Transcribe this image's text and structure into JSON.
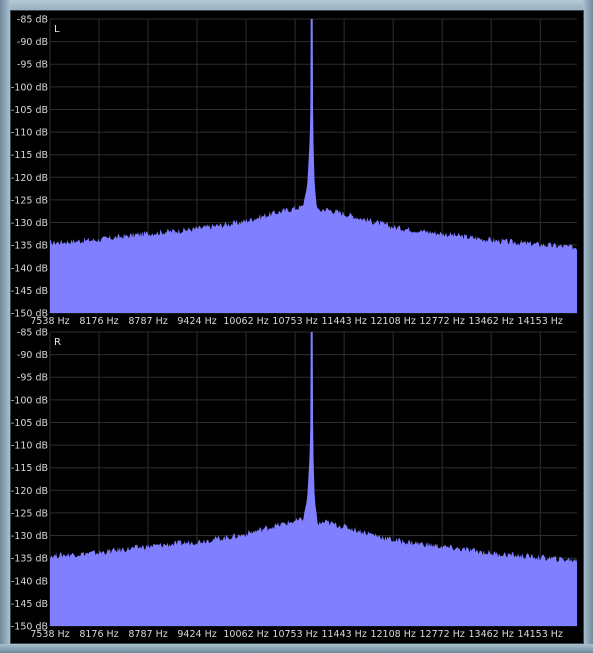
{
  "chart_data": [
    {
      "type": "area",
      "channel": "L",
      "ylabel_unit": "dB",
      "ylim": [
        -150,
        -85
      ],
      "y_ticks": [
        "-85 dB",
        "-90 dB",
        "-95 dB",
        "-100 dB",
        "-105 dB",
        "-110 dB",
        "-115 dB",
        "-120 dB",
        "-125 dB",
        "-130 dB",
        "-135 dB",
        "-140 dB",
        "-145 dB",
        "-150 dB"
      ],
      "x_ticks": [
        "7538 Hz",
        "8176 Hz",
        "8787 Hz",
        "9424 Hz",
        "10062 Hz",
        "10753 Hz",
        "11443 Hz",
        "12108 Hz",
        "12772 Hz",
        "13462 Hz",
        "14153 Hz"
      ],
      "xlim": [
        7538,
        14550
      ],
      "grid": true,
      "series": [
        {
          "color": "#7f7fff",
          "x": [
            7538,
            8176,
            8787,
            9424,
            10062,
            10500,
            10753,
            10900,
            10960,
            11000,
            11020,
            11040,
            11060,
            11100,
            11200,
            11443,
            12108,
            12772,
            13462,
            14153,
            14550
          ],
          "y": [
            -134.5,
            -133.8,
            -132.5,
            -131.5,
            -130,
            -128,
            -127,
            -126.5,
            -122,
            -110,
            -85,
            -110,
            -122,
            -127.5,
            -127,
            -128,
            -131,
            -132.5,
            -134,
            -135,
            -135.5
          ]
        }
      ]
    },
    {
      "type": "area",
      "channel": "R",
      "ylabel_unit": "dB",
      "ylim": [
        -150,
        -85
      ],
      "y_ticks": [
        "-85 dB",
        "-90 dB",
        "-95 dB",
        "-100 dB",
        "-105 dB",
        "-110 dB",
        "-115 dB",
        "-120 dB",
        "-125 dB",
        "-130 dB",
        "-135 dB",
        "-140 dB",
        "-145 dB",
        "-150 dB"
      ],
      "x_ticks": [
        "7538 Hz",
        "8176 Hz",
        "8787 Hz",
        "9424 Hz",
        "10062 Hz",
        "10753 Hz",
        "11443 Hz",
        "12108 Hz",
        "12772 Hz",
        "13462 Hz",
        "14153 Hz"
      ],
      "xlim": [
        7538,
        14550
      ],
      "grid": true,
      "series": [
        {
          "color": "#7f7fff",
          "x": [
            7538,
            8176,
            8787,
            9424,
            10062,
            10500,
            10753,
            10900,
            10960,
            11000,
            11020,
            11040,
            11060,
            11100,
            11200,
            11443,
            12108,
            12772,
            13462,
            14153,
            14550
          ],
          "y": [
            -134.5,
            -133.8,
            -132.5,
            -131.5,
            -130,
            -128,
            -127,
            -126.5,
            -122,
            -110,
            -85,
            -110,
            -122,
            -127.5,
            -127,
            -128,
            -131,
            -132.5,
            -134,
            -135,
            -135.5
          ]
        }
      ]
    }
  ]
}
